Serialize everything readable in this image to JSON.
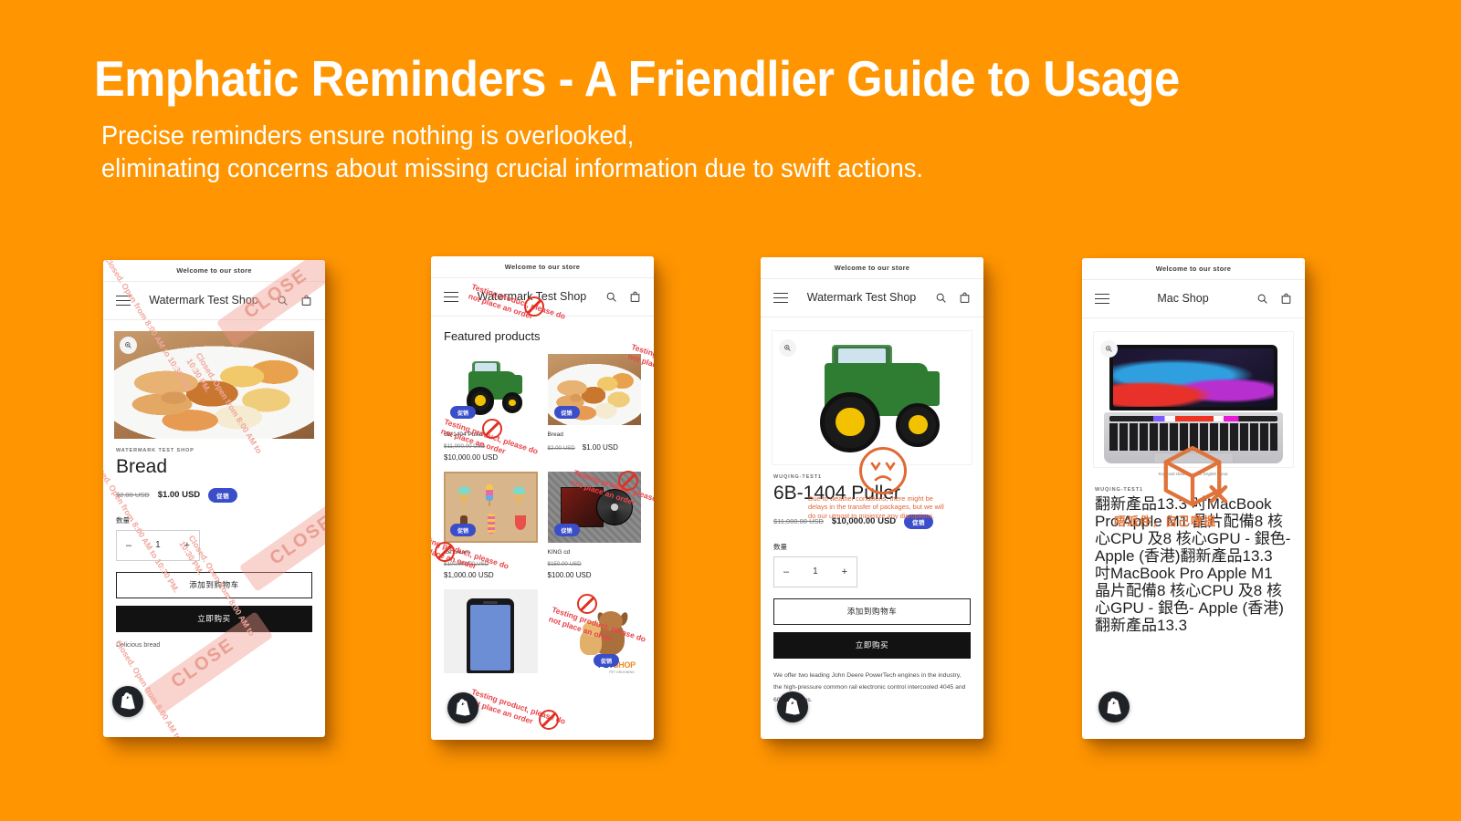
{
  "slide": {
    "background_color": "#FF9500",
    "title": "Emphatic Reminders - A Friendlier Guide to Usage",
    "subtitle_line1": "Precise reminders ensure nothing is overlooked,",
    "subtitle_line2": "eliminating concerns about missing crucial information due to swift actions."
  },
  "common": {
    "announcement": "Welcome to our store",
    "menu_icon": "hamburger-menu-icon",
    "search_icon": "search-icon",
    "cart_icon": "shopping-bag-icon",
    "zoom_icon": "zoom-in-icon",
    "sale_badge": "促销",
    "qty_label": "数量",
    "qty_value": "1",
    "minus": "–",
    "plus": "+",
    "add_to_cart": "添加到购物车",
    "buy_now": "立即购买",
    "sale_badge_color": "#3B4EC9"
  },
  "mockups": [
    {
      "id": "mockup-1-product-bread",
      "shop_name": "Watermark Test Shop",
      "vendor": "WATERMARK TEST SHOP",
      "product_title": "Bread",
      "old_price": "$2.00 USD",
      "new_price": "$1.00 USD",
      "description": "Delicious bread",
      "watermark": {
        "type": "closed-hours-notice",
        "text": "Closed. Open from 8:00 AM to 10:30 PM.",
        "tag_label": "CLOSE",
        "color": "#F0A79C"
      }
    },
    {
      "id": "mockup-2-featured-products",
      "shop_name": "Watermark Test Shop",
      "section_title": "Featured products",
      "products": [
        {
          "name": "6B-1404 Puller",
          "old_price": "$11,000.00 USD",
          "new_price": "$10,000.00 USD",
          "image": "green-tractor"
        },
        {
          "name": "Bread",
          "old_price": "$2.00 USD",
          "new_price": "$1.00 USD",
          "image": "bread-plate"
        },
        {
          "name": "Ice cream",
          "old_price": "$100,000.00 USD",
          "new_price": "$1,000.00 USD",
          "image": "ice-cream-illustration"
        },
        {
          "name": "KING cd",
          "old_price": "$150.00 USD",
          "new_price": "$100.00 USD",
          "image": "cd-album"
        },
        {
          "name": "",
          "old_price": "",
          "new_price": "",
          "image": "smartphone-illustration"
        },
        {
          "name": "",
          "old_price": "",
          "new_price": "",
          "image": "petshop-logo"
        }
      ],
      "watermark": {
        "type": "testing-product-notice",
        "text": "Testing product, please do not place an order",
        "color": "#E8454A"
      }
    },
    {
      "id": "mockup-3-product-puller",
      "shop_name": "Watermark Test Shop",
      "vendor": "WUQING-TEST1",
      "product_title": "6B-1404 Puller",
      "old_price": "$11,000.00 USD",
      "new_price": "$10,000.00 USD",
      "description": "We offer two leading John Deere PowerTech engines in the industry, the high-pressure common rail electronic control intercooled 4045 and 6068 engines.",
      "watermark": {
        "type": "weather-delay-notice",
        "text": "Due to weather conditions, there might be delays in the transfer of packages, but we will do our utmost to minimize any disruptions.",
        "icon": "sad-face-icon",
        "color": "#E0663A"
      }
    },
    {
      "id": "mockup-4-product-macbook",
      "shop_name": "Mac Shop",
      "vendor": "WUQING-TEST1",
      "product_title": "翻新產品13.3 吋MacBook Pro Apple M1 晶片配備8 核心CPU 及8 核心GPU - 銀色- Apple (香港)翻新產品13.3 吋MacBook Pro Apple M1 晶片配備8 核心CPU 及8 核心GPU - 銀色- Apple (香港) 翻新產品13.3",
      "image_caption": "Keyboard shown in a U.S. English layout.",
      "watermark": {
        "type": "no-delivery-notice",
        "text": "唔派件，自己嚟搵",
        "icon": "box-with-x-icon",
        "color": "#E0733A"
      }
    }
  ]
}
